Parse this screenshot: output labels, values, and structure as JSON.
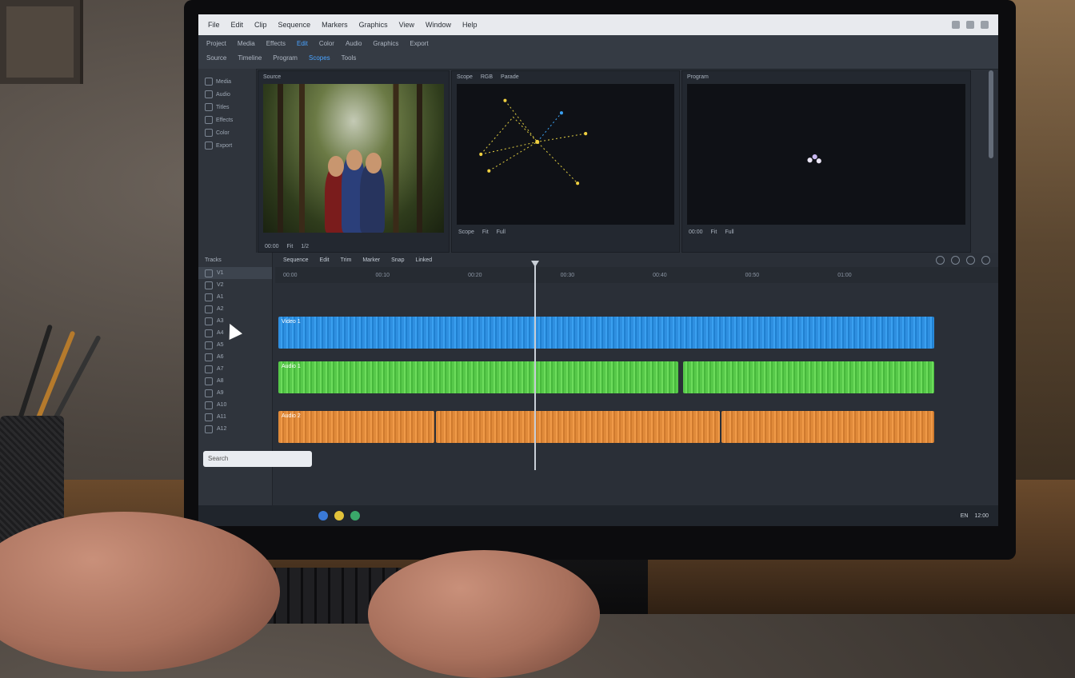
{
  "app": {
    "menubar": [
      "File",
      "Edit",
      "Clip",
      "Sequence",
      "Markers",
      "Graphics",
      "View",
      "Window",
      "Help"
    ],
    "toolbar_row1": [
      "Project",
      "Media",
      "Effects",
      "Edit",
      "Color",
      "Audio",
      "Graphics",
      "Export"
    ],
    "toolbar_row2": [
      "Source",
      "Timeline",
      "Program",
      "Scopes",
      "Tools"
    ]
  },
  "sidebar": {
    "items": [
      "Media",
      "Audio",
      "Titles",
      "Effects",
      "Color",
      "Export"
    ]
  },
  "viewers": {
    "source": {
      "head": [
        "Source"
      ],
      "foot": [
        "00:00",
        "Fit",
        "1/2"
      ]
    },
    "scope": {
      "head": [
        "Scope",
        "RGB",
        "Parade"
      ],
      "foot": [
        "Scope",
        "Fit",
        "Full"
      ]
    },
    "program": {
      "head": [
        "Program"
      ],
      "foot": [
        "00:00",
        "Fit",
        "Full"
      ]
    }
  },
  "timeline": {
    "left_head": "Tracks",
    "tracks": [
      "V1",
      "V2",
      "A1",
      "A2",
      "A3",
      "A4",
      "A5",
      "A6",
      "A7",
      "A8",
      "A9",
      "A10",
      "A11",
      "A12"
    ],
    "search_placeholder": "Search",
    "toolbar": [
      "Sequence",
      "Edit",
      "Trim",
      "Marker",
      "Snap",
      "Linked"
    ],
    "ruler": [
      "00:00",
      "00:10",
      "00:20",
      "00:30",
      "00:40",
      "00:50",
      "01:00"
    ],
    "clips": {
      "video": [
        {
          "label": "Video 1",
          "color": "#2f8fe0"
        }
      ],
      "audio_green": [
        {
          "label": "Audio 1",
          "color": "#57c94a"
        }
      ],
      "audio_orange": [
        {
          "label": "Audio 2",
          "color": "#e08a3a"
        }
      ]
    }
  },
  "taskbar": {
    "tray": [
      "EN",
      "12:00"
    ]
  },
  "icons": [
    "minimize-icon",
    "maximize-icon",
    "close-icon",
    "play-icon",
    "cursor-icon",
    "search-icon"
  ]
}
